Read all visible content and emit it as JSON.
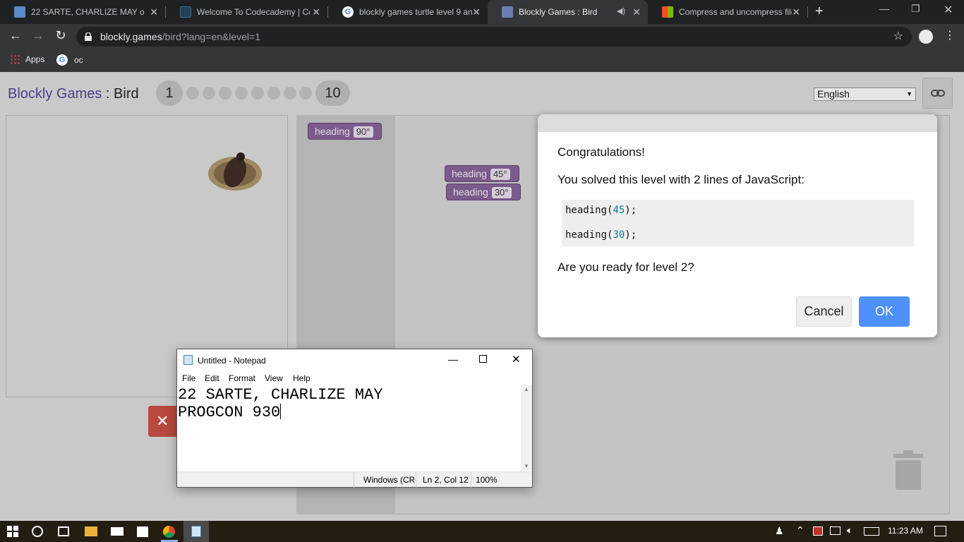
{
  "browser": {
    "tabs": [
      {
        "title": "22 SARTE, CHARLIZE MAY on 2...",
        "active": false
      },
      {
        "title": "Welcome To Codecademy | Co...",
        "active": false
      },
      {
        "title": "blockly games turtle level 9 an...",
        "active": false
      },
      {
        "title": "Blockly Games : Bird",
        "active": true
      },
      {
        "title": "Compress and uncompress file...",
        "active": false
      }
    ],
    "new_tab": "+",
    "url_host": "blockly.games",
    "url_path": "/bird?lang=en&level=1",
    "bookmarks": [
      {
        "label": "Apps"
      },
      {
        "label": "oc"
      }
    ]
  },
  "app": {
    "brand": "Blockly Games",
    "separator": " : ",
    "game": "Bird",
    "levels": {
      "first": "1",
      "last": "10"
    },
    "language": "English"
  },
  "blocks": {
    "toolbox": {
      "label": "heading",
      "value": "90°"
    },
    "workspace": [
      {
        "label": "heading",
        "value": "45°"
      },
      {
        "label": "heading",
        "value": "30°"
      }
    ]
  },
  "dialog": {
    "line1": "Congratulations!",
    "line2": "You solved this level with 2 lines of JavaScript:",
    "code": [
      {
        "fn": "heading(",
        "num": "45",
        "end": ");"
      },
      {
        "fn": "heading(",
        "num": "30",
        "end": ");"
      }
    ],
    "line3": "Are you ready for level 2?",
    "cancel": "Cancel",
    "ok": "OK"
  },
  "notepad": {
    "title": "Untitled - Notepad",
    "menu": [
      "File",
      "Edit",
      "Format",
      "View",
      "Help"
    ],
    "lines": [
      "22 SARTE, CHARLIZE MAY",
      "PROGCON 930"
    ],
    "status": {
      "encoding": "Windows (CR",
      "position": "Ln 2, Col 12",
      "zoom": "100%"
    }
  },
  "taskbar": {
    "time": "11:23 AM"
  },
  "colors": {
    "brand_purple": "#4a3f8f",
    "block_purple": "#7b5b8c",
    "ok_blue": "#4d90fe",
    "reset_red": "#b8493e"
  }
}
